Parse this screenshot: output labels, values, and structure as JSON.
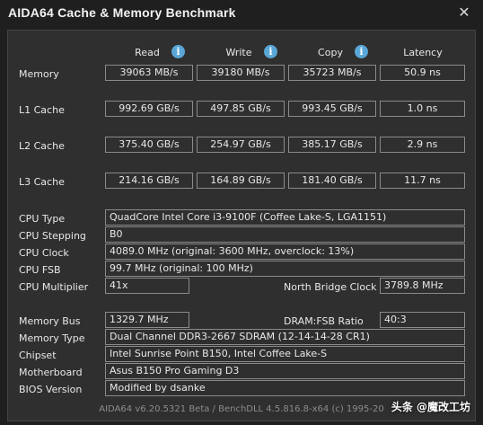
{
  "window": {
    "title": "AIDA64 Cache & Memory Benchmark",
    "close_glyph": "✕"
  },
  "headers": {
    "read": "Read",
    "write": "Write",
    "copy": "Copy",
    "latency": "Latency",
    "info_glyph": "i"
  },
  "bench": {
    "memory": {
      "label": "Memory",
      "read": "39063 MB/s",
      "write": "39180 MB/s",
      "copy": "35723 MB/s",
      "latency": "50.9 ns"
    },
    "l1": {
      "label": "L1 Cache",
      "read": "992.69 GB/s",
      "write": "497.85 GB/s",
      "copy": "993.45 GB/s",
      "latency": "1.0 ns"
    },
    "l2": {
      "label": "L2 Cache",
      "read": "375.40 GB/s",
      "write": "254.97 GB/s",
      "copy": "385.17 GB/s",
      "latency": "2.9 ns"
    },
    "l3": {
      "label": "L3 Cache",
      "read": "214.16 GB/s",
      "write": "164.89 GB/s",
      "copy": "181.40 GB/s",
      "latency": "11.7 ns"
    }
  },
  "cpu": {
    "type_label": "CPU Type",
    "type_value": "QuadCore Intel Core i3-9100F  (Coffee Lake-S, LGA1151)",
    "stepping_label": "CPU Stepping",
    "stepping_value": "B0",
    "clock_label": "CPU Clock",
    "clock_value": "4089.0 MHz  (original: 3600 MHz, overclock: 13%)",
    "fsb_label": "CPU FSB",
    "fsb_value": "99.7 MHz  (original: 100 MHz)",
    "multiplier_label": "CPU Multiplier",
    "multiplier_value": "41x",
    "nb_clock_label": "North Bridge Clock",
    "nb_clock_value": "3789.8 MHz"
  },
  "system": {
    "bus_label": "Memory Bus",
    "bus_value": "1329.7 MHz",
    "ratio_label": "DRAM:FSB Ratio",
    "ratio_value": "40:3",
    "memtype_label": "Memory Type",
    "memtype_value": "Dual Channel DDR3-2667 SDRAM  (12-14-14-28 CR1)",
    "chipset_label": "Chipset",
    "chipset_value": "Intel Sunrise Point B150, Intel Coffee Lake-S",
    "mobo_label": "Motherboard",
    "mobo_value": "Asus B150 Pro Gaming D3",
    "bios_label": "BIOS Version",
    "bios_value": "Modified by dsanke"
  },
  "footer": {
    "text": "AIDA64 v6.20.5321 Beta / BenchDLL 4.5.816.8-x64  (c) 1995-20",
    "watermark": "头条 @魔改工坊"
  }
}
